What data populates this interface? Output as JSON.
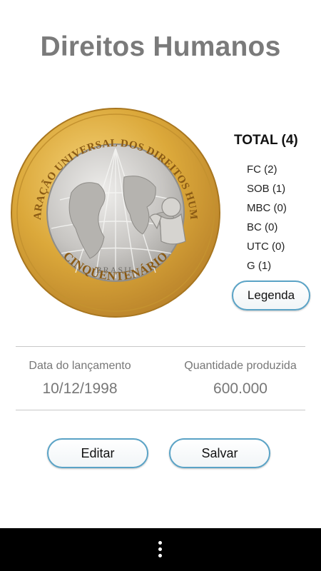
{
  "header": {
    "title": "Direitos Humanos"
  },
  "coin": {
    "top_text": "DECLARAÇÃO UNIVERSAL DOS DIREITOS HUMANOS",
    "bottom_text": "CINQÜENTENÁRIO",
    "country": "BRASIL"
  },
  "total": {
    "label": "TOTAL (4)"
  },
  "counts": [
    {
      "label": "FC (2)"
    },
    {
      "label": "SOB (1)"
    },
    {
      "label": "MBC (0)"
    },
    {
      "label": "BC (0)"
    },
    {
      "label": "UTC (0)"
    },
    {
      "label": "G (1)"
    }
  ],
  "buttons": {
    "legend": "Legenda",
    "edit": "Editar",
    "save": "Salvar"
  },
  "stats": {
    "launch_label": "Data do lançamento",
    "launch_value": "10/12/1998",
    "quantity_label": "Quantidade produzida",
    "quantity_value": "600.000"
  },
  "colors": {
    "accent_border": "#5aa3c6",
    "title_gray": "#7a7a7a",
    "coin_gold": "#d9a93a",
    "coin_silver": "#c9c7c4"
  },
  "icons": {
    "nav_menu": "overflow-menu-icon"
  }
}
